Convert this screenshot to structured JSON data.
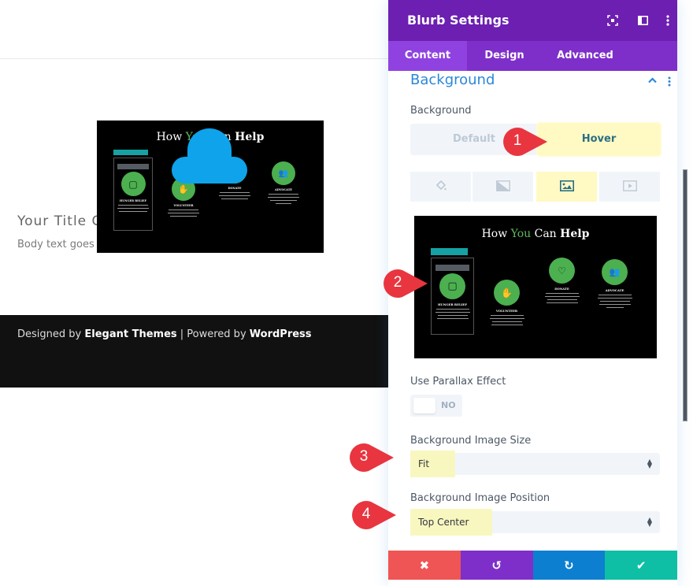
{
  "page": {
    "content_title": "Your Title Goes Here",
    "content_body": "Body text goes here",
    "footer": {
      "prefix": "Designed by ",
      "brand": "Elegant Themes",
      "separator": " | Powered by ",
      "platform": "WordPress"
    }
  },
  "preview": {
    "title_part1": "How ",
    "title_highlight": "You",
    "title_part2": " Can ",
    "title_bold": "Help",
    "cards": [
      {
        "heading": "HUNGER RELIEF",
        "icon": "shopping-bag-icon",
        "glyph": "▢"
      },
      {
        "heading": "VOLUNTEER",
        "icon": "hand-heart-icon",
        "glyph": "✋"
      },
      {
        "heading": "DONATE",
        "icon": "heart-coin-icon",
        "glyph": "♡"
      },
      {
        "heading": "ADVOCATE",
        "icon": "users-icon",
        "glyph": "👥"
      }
    ]
  },
  "panel": {
    "title": "Blurb Settings",
    "header_icons": [
      "focus-mode-icon",
      "sidebar-layout-icon",
      "more-options-icon"
    ],
    "tabs": [
      {
        "label": "Content",
        "active": true
      },
      {
        "label": "Design",
        "active": false
      },
      {
        "label": "Advanced",
        "active": false
      }
    ],
    "section_title": "Background",
    "background_label": "Background",
    "state_toggle": {
      "default": "Default",
      "hover": "Hover",
      "selected": "Hover"
    },
    "background_types": [
      {
        "name": "color",
        "icon": "paint-bucket-icon",
        "active": false
      },
      {
        "name": "gradient",
        "icon": "gradient-icon",
        "active": false
      },
      {
        "name": "image",
        "icon": "image-icon",
        "active": true
      },
      {
        "name": "video",
        "icon": "video-icon",
        "active": false
      }
    ],
    "parallax_label": "Use Parallax Effect",
    "parallax_value": "NO",
    "image_size_label": "Background Image Size",
    "image_size_value": "Fit",
    "image_position_label": "Background Image Position",
    "image_position_value": "Top Center",
    "footer_buttons": [
      {
        "name": "discard",
        "glyph": "✖",
        "color": "#ef5555"
      },
      {
        "name": "undo",
        "glyph": "↺",
        "color": "#7e2fc9"
      },
      {
        "name": "redo",
        "glyph": "↻",
        "color": "#0c7fd1"
      },
      {
        "name": "save",
        "glyph": "✔",
        "color": "#0fbfa5"
      }
    ]
  },
  "callouts": [
    "1",
    "2",
    "3",
    "4"
  ],
  "colors": {
    "header_purple": "#6c1fb0",
    "tab_purple": "#7e2fc9",
    "accent_blue": "#2b87da",
    "highlight_yellow": "#fff9c4",
    "callout_red": "#e8353f",
    "cloud_blue": "#0ea3ea"
  }
}
